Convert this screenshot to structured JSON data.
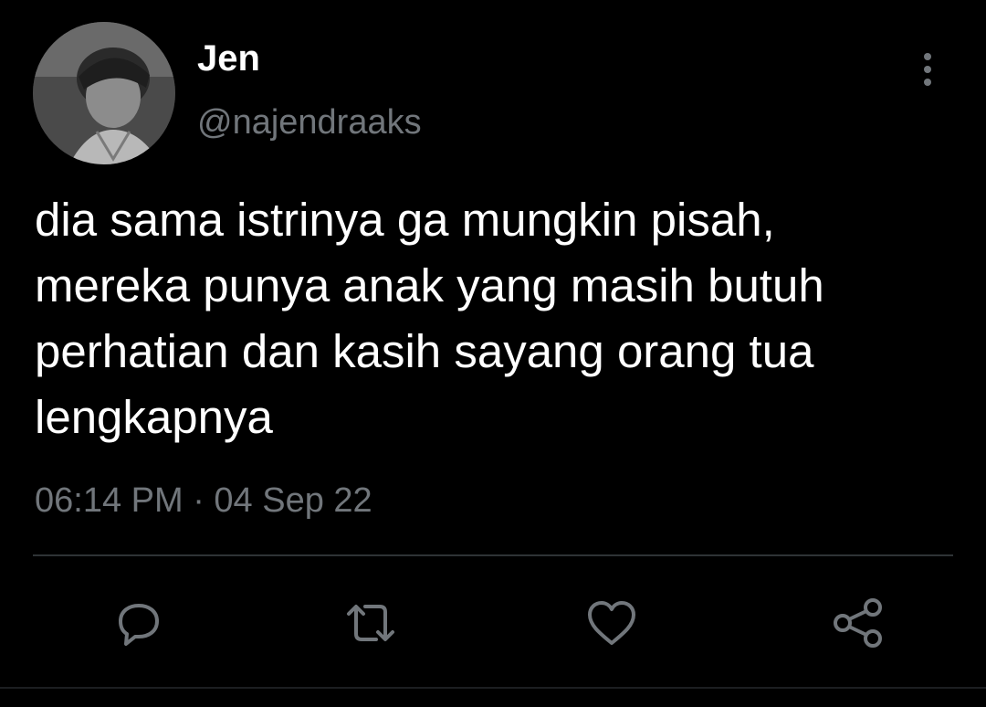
{
  "user": {
    "display_name": "Jen",
    "handle": "@najendraaks",
    "avatar_icon": "avatar-photo"
  },
  "tweet": {
    "text": "dia sama istrinya ga mungkin pisah,\nmereka punya anak yang masih butuh\nperhatian dan kasih sayang orang tua\nlengkapnya",
    "timestamp": "06:14 PM · 04 Sep 22"
  },
  "actions": [
    {
      "name": "reply",
      "icon": "reply-icon"
    },
    {
      "name": "retweet",
      "icon": "retweet-icon"
    },
    {
      "name": "like",
      "icon": "heart-icon"
    },
    {
      "name": "share",
      "icon": "share-icon"
    }
  ],
  "colors": {
    "background": "#000000",
    "primary_text": "#ffffff",
    "secondary_text": "#71767b",
    "divider": "#2f3336"
  }
}
